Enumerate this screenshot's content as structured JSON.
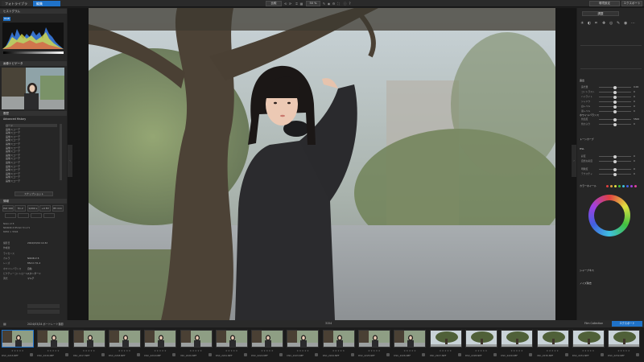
{
  "topbar": {
    "library_tab": "フォトライブラリ",
    "edit_tab": "編集",
    "compare_btn": "比較",
    "zoom_value": "50 %",
    "right_buttons": [
      "環境設定",
      "エクスポート"
    ]
  },
  "left": {
    "histogram_title": "ヒストグラム",
    "histogram_mode": "RGB",
    "navigator_title": "画像ナビゲータ",
    "history_title": "履歴",
    "history_section": "Advanced History",
    "history_items": [
      "ロード",
      "画像スコーデ",
      "画像スコーデ",
      "画像スコーデ",
      "画像スコーデ",
      "画像スコーデ",
      "画像スコーデ",
      "画像スコーデ",
      "画像スコーデ",
      "画像スコーデ",
      "画像スコーデ",
      "画像スコーデ",
      "画像スコーデ",
      "画像スコーデ",
      "画像スコーデ",
      "画像スコーデ"
    ],
    "snapshot_btn": "スナップショット",
    "info_title": "情報",
    "exif": [
      "ISO 100",
      "f/1.2",
      "1/200 s",
      "+0 EV",
      "85 mm"
    ],
    "camera": "Nikon Z 8",
    "lens": "NIKKOR Z 85mm f/1.2 S",
    "size": "8256 × 5504",
    "meta": [
      {
        "k": "撮影日",
        "v": "2024/03/24 14:32"
      },
      {
        "k": "作成者",
        "v": ""
      },
      {
        "k": "ライセンス",
        "v": ""
      },
      {
        "k": "カメラ",
        "v": "NIKON Z 8"
      },
      {
        "k": "レンズ",
        "v": "85mm f/1.2"
      },
      {
        "k": "ホワイトバランス",
        "v": "自動"
      },
      {
        "k": "ピクチャーコントロール",
        "v": "スタンダード"
      },
      {
        "k": "測光",
        "v": "マルチ"
      }
    ]
  },
  "right": {
    "panel_title": "調整",
    "sections": [
      "露出",
      "ホワイトバランス",
      "トーンカーブ",
      "HSL",
      "カラーホイール",
      "シャープネス",
      "ノイズ除去"
    ],
    "sliders": [
      {
        "label": "露光量",
        "value": "0.00"
      },
      {
        "label": "コントラスト",
        "value": "0"
      },
      {
        "label": "ハイライト",
        "value": "0"
      },
      {
        "label": "シャドウ",
        "value": "0"
      },
      {
        "label": "白レベル",
        "value": "0"
      },
      {
        "label": "黒レベル",
        "value": "0"
      },
      {
        "label": "色温度",
        "value": "5500"
      },
      {
        "label": "色かぶり",
        "value": "0"
      },
      {
        "label": "彩度",
        "value": "0"
      },
      {
        "label": "自然な彩度",
        "value": "0"
      },
      {
        "label": "明瞭度",
        "value": "0"
      },
      {
        "label": "テクスチャ",
        "value": "0"
      }
    ]
  },
  "strip": {
    "folder": "2024/03/24 ポートレート撮影",
    "count": "3154",
    "filter_label": "Film Collection",
    "export_label": "エクスポート",
    "files": [
      "DSC_2215.NEF",
      "DSC_2216.NEF",
      "DSC_2217.NEF",
      "DSC_2218.NEF",
      "DSC_2219.NEF",
      "DSC_2220.NEF",
      "DSC_2221.NEF",
      "DSC_2222.NEF",
      "DSC_2223.NEF",
      "DSC_2224.NEF",
      "DSC_2225.NEF",
      "DSC_2226.NEF",
      "DSC_2227.NEF",
      "DSC_2228.NEF",
      "DSC_2229.NEF",
      "DSC_2230.NEF",
      "DSC_2231.NEF",
      "DSC_2232.NEF"
    ]
  },
  "colors": {
    "accent": "#1f72c8",
    "panel": "#262626"
  }
}
